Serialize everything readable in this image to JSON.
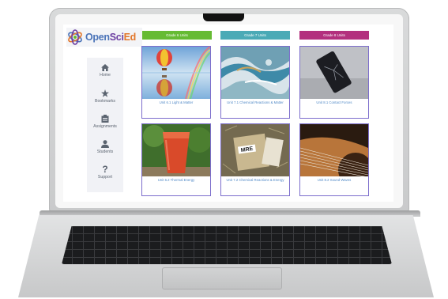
{
  "app": {
    "logo": {
      "open": "Open",
      "sci": "Sci",
      "ed": "Ed"
    }
  },
  "sidebar": {
    "items": [
      {
        "label": "Home",
        "icon": "home-icon"
      },
      {
        "label": "Bookmarks",
        "icon": "star-icon"
      },
      {
        "label": "Assignments",
        "icon": "clipboard-icon"
      },
      {
        "label": "Students",
        "icon": "user-icon"
      },
      {
        "label": "Support",
        "icon": "question-icon"
      }
    ]
  },
  "grades": [
    {
      "label": "Grade 6 Units",
      "color": "#66bb33"
    },
    {
      "label": "Grade 7 Units",
      "color": "#4aaab6"
    },
    {
      "label": "Grade 8 Units",
      "color": "#b3307e"
    }
  ],
  "units": [
    {
      "caption": "Unit 6.1 Light & Matter",
      "image": "hot-air-balloon-reflection-image"
    },
    {
      "caption": "Unit 7.1 Chemical Reactions & Matter",
      "image": "marbled-fluid-art-image"
    },
    {
      "caption": "Unit 8.1 Contact Forces",
      "image": "cracked-phone-image"
    },
    {
      "caption": "Unit 6.2 Thermal Energy",
      "image": "iced-drink-cup-image"
    },
    {
      "caption": "Unit 7.2 Chemical Reactions & Energy",
      "image": "mre-ration-pack-image"
    },
    {
      "caption": "Unit 8.2 Sound Waves",
      "image": "guitar-strings-image"
    }
  ],
  "colors": {
    "card_border": "#7c6dcc",
    "caption_text": "#4f88c6",
    "sidebar_bg": "#f1f2f6"
  }
}
